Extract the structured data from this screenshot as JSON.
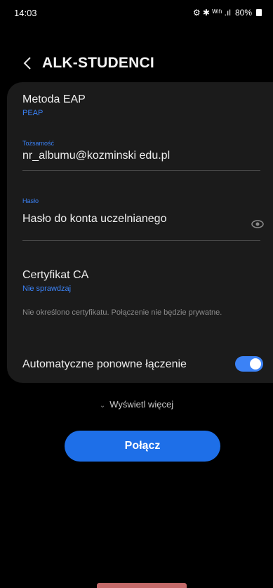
{
  "status_bar": {
    "time": "14:03",
    "indicators": "⚙ ✱ ᵂᶦᶠᶦ .ıl",
    "battery_text": "80%"
  },
  "header": {
    "title": "ALK-STUDENCI"
  },
  "form": {
    "eap_label": "Metoda EAP",
    "eap_value": "PEAP",
    "identity_label": "Tożsamość",
    "identity_value": "nr_albumu@kozminski edu.pl",
    "password_label": "Hasło",
    "password_value": "Hasło do konta uczelnianego",
    "ca_label": "Certyfikat CA",
    "ca_value": "Nie sprawdzaj",
    "ca_hint": "Nie określono certyfikatu. Połączenie nie będzie prywatne.",
    "auto_reconnect_label": "Automatyczne ponowne łączenie",
    "auto_reconnect_on": true
  },
  "more_label": "Wyświetl więcej",
  "connect_label": "Połącz",
  "colors": {
    "accent": "#1e6fe8",
    "link": "#3b82f6",
    "card": "#1b1b1b",
    "background": "#000000"
  }
}
